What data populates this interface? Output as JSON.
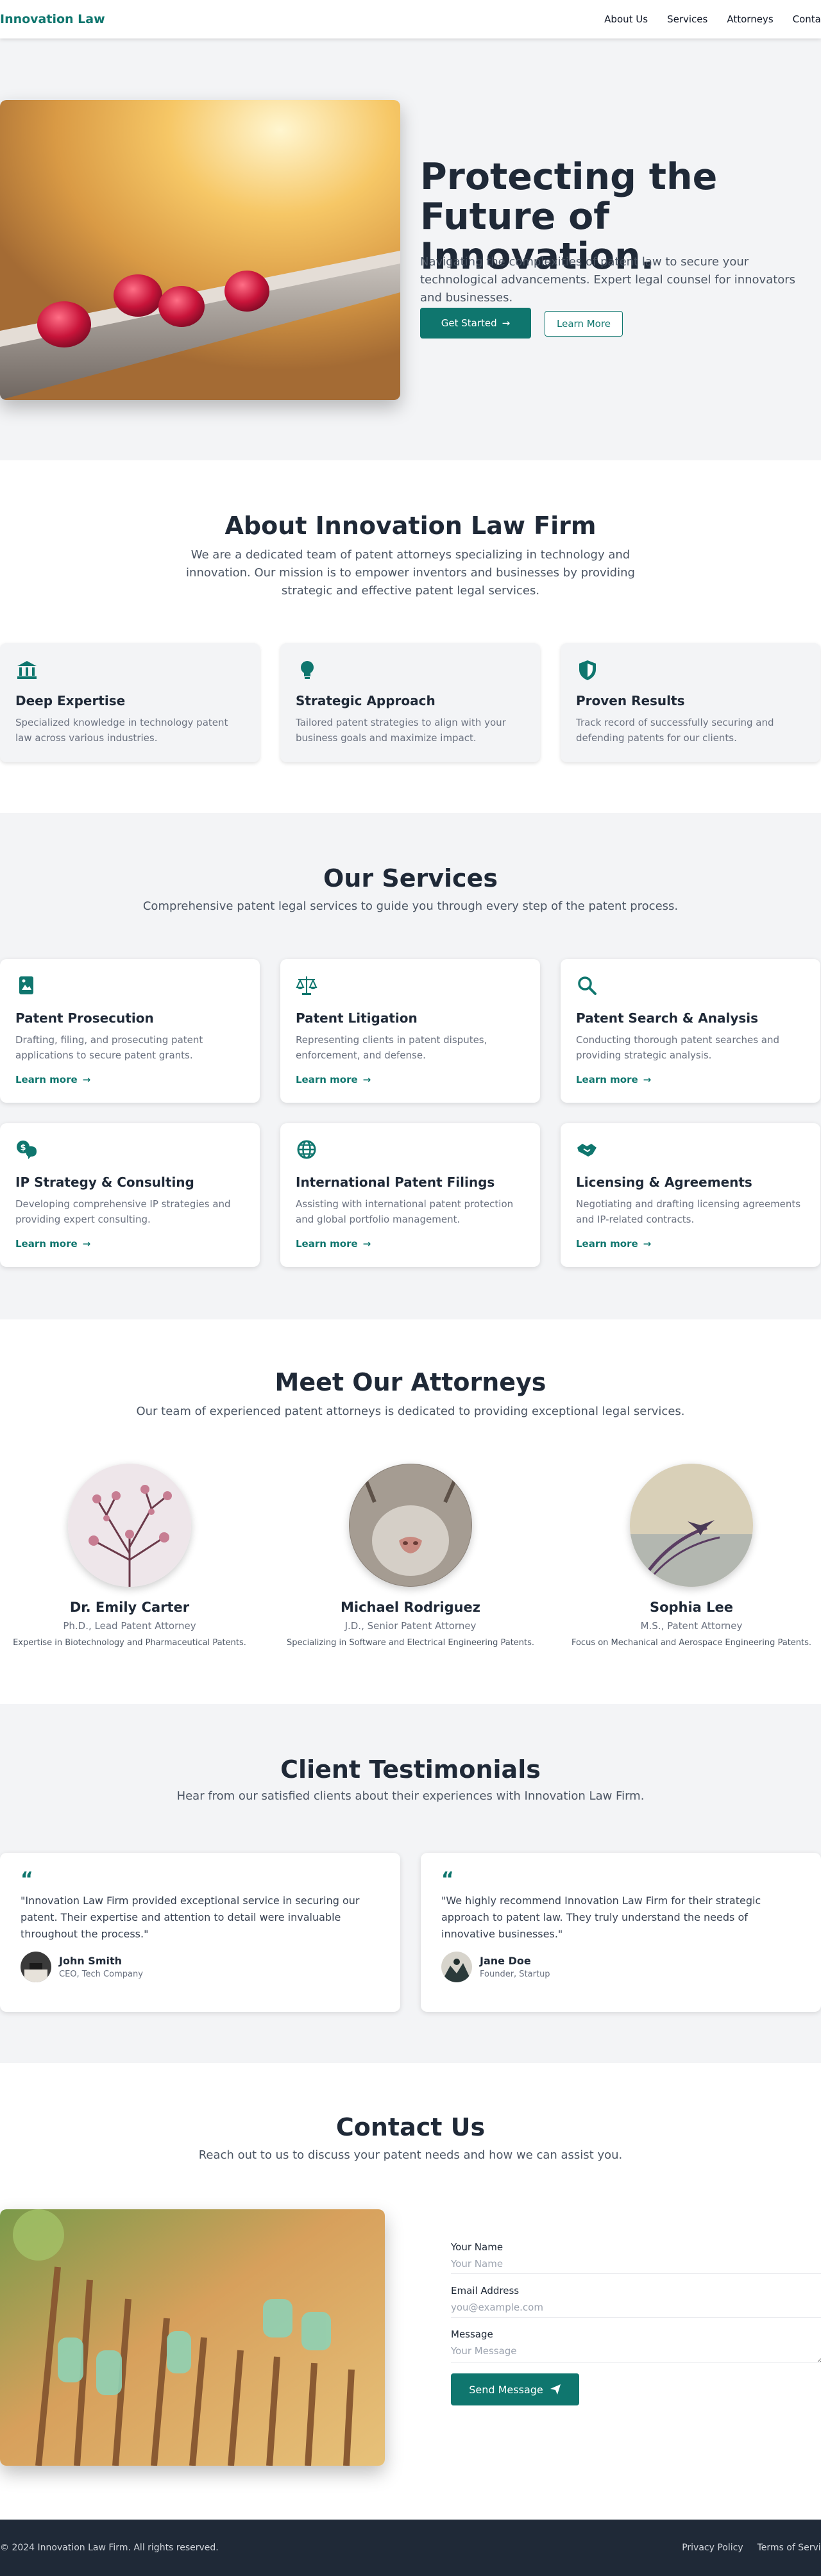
{
  "header": {
    "logo": "Innovation Law",
    "nav": [
      "About Us",
      "Services",
      "Attorneys",
      "Contact"
    ]
  },
  "hero": {
    "title": "Protecting the Future of Innovation.",
    "subtitle": "Navigating the complexities of patent law to secure your technological advancements. Expert legal counsel for innovators and businesses.",
    "primary_button": "Get Started",
    "secondary_button": "Learn More"
  },
  "about": {
    "title": "About Innovation Law Firm",
    "subtitle": "We are a dedicated team of patent attorneys specializing in technology and innovation. Our mission is to empower inventors and businesses by providing strategic and effective patent legal services.",
    "cards": [
      {
        "icon": "bank-icon",
        "title": "Deep Expertise",
        "text": "Specialized knowledge in technology patent law across various industries."
      },
      {
        "icon": "lightbulb-icon",
        "title": "Strategic Approach",
        "text": "Tailored patent strategies to align with your business goals and maximize impact."
      },
      {
        "icon": "shield-icon",
        "title": "Proven Results",
        "text": "Track record of successfully securing and defending patents for our clients."
      }
    ]
  },
  "services": {
    "title": "Our Services",
    "subtitle": "Comprehensive patent legal services to guide you through every step of the patent process.",
    "link_label": "Learn more",
    "items": [
      {
        "icon": "document-icon",
        "title": "Patent Prosecution",
        "text": "Drafting, filing, and prosecuting patent applications to secure patent grants."
      },
      {
        "icon": "scale-icon",
        "title": "Patent Litigation",
        "text": "Representing clients in patent disputes, enforcement, and defense."
      },
      {
        "icon": "search-icon",
        "title": "Patent Search & Analysis",
        "text": "Conducting thorough patent searches and providing strategic analysis."
      },
      {
        "icon": "strategy-icon",
        "title": "IP Strategy & Consulting",
        "text": "Developing comprehensive IP strategies and providing expert consulting."
      },
      {
        "icon": "globe-icon",
        "title": "International Patent Filings",
        "text": "Assisting with international patent protection and global portfolio management."
      },
      {
        "icon": "handshake-icon",
        "title": "Licensing & Agreements",
        "text": "Negotiating and drafting licensing agreements and IP-related contracts."
      }
    ]
  },
  "attorneys": {
    "title": "Meet Our Attorneys",
    "subtitle": "Our team of experienced patent attorneys is dedicated to providing exceptional legal services.",
    "people": [
      {
        "name": "Dr. Emily Carter",
        "role": "Ph.D., Lead Patent Attorney",
        "spec": "Expertise in Biotechnology and Pharmaceutical Patents."
      },
      {
        "name": "Michael Rodriguez",
        "role": "J.D., Senior Patent Attorney",
        "spec": "Specializing in Software and Electrical Engineering Patents."
      },
      {
        "name": "Sophia Lee",
        "role": "M.S., Patent Attorney",
        "spec": "Focus on Mechanical and Aerospace Engineering Patents."
      }
    ]
  },
  "testimonials": {
    "title": "Client Testimonials",
    "subtitle": "Hear from our satisfied clients about their experiences with Innovation Law Firm.",
    "items": [
      {
        "quote": "\"Innovation Law Firm provided exceptional service in securing our patent. Their expertise and attention to detail were invaluable throughout the process.\"",
        "name": "John Smith",
        "role": "CEO, Tech Company"
      },
      {
        "quote": "\"We highly recommend Innovation Law Firm for their strategic approach to patent law. They truly understand the needs of innovative businesses.\"",
        "name": "Jane Doe",
        "role": "Founder, Startup"
      }
    ]
  },
  "contact": {
    "title": "Contact Us",
    "subtitle": "Reach out to us to discuss your patent needs and how we can assist you.",
    "name_label": "Your Name",
    "name_placeholder": "Your Name",
    "email_label": "Email Address",
    "email_placeholder": "you@example.com",
    "message_label": "Message",
    "message_placeholder": "Your Message",
    "send_button": "Send Message"
  },
  "footer": {
    "copyright": "© 2024 Innovation Law Firm. All rights reserved.",
    "links": [
      "Privacy Policy",
      "Terms of Service"
    ]
  },
  "colors": {
    "brand": "#0f766e",
    "text_dark": "#1f2937",
    "footer_bg": "#1f2937",
    "section_gray": "#f3f4f6"
  }
}
